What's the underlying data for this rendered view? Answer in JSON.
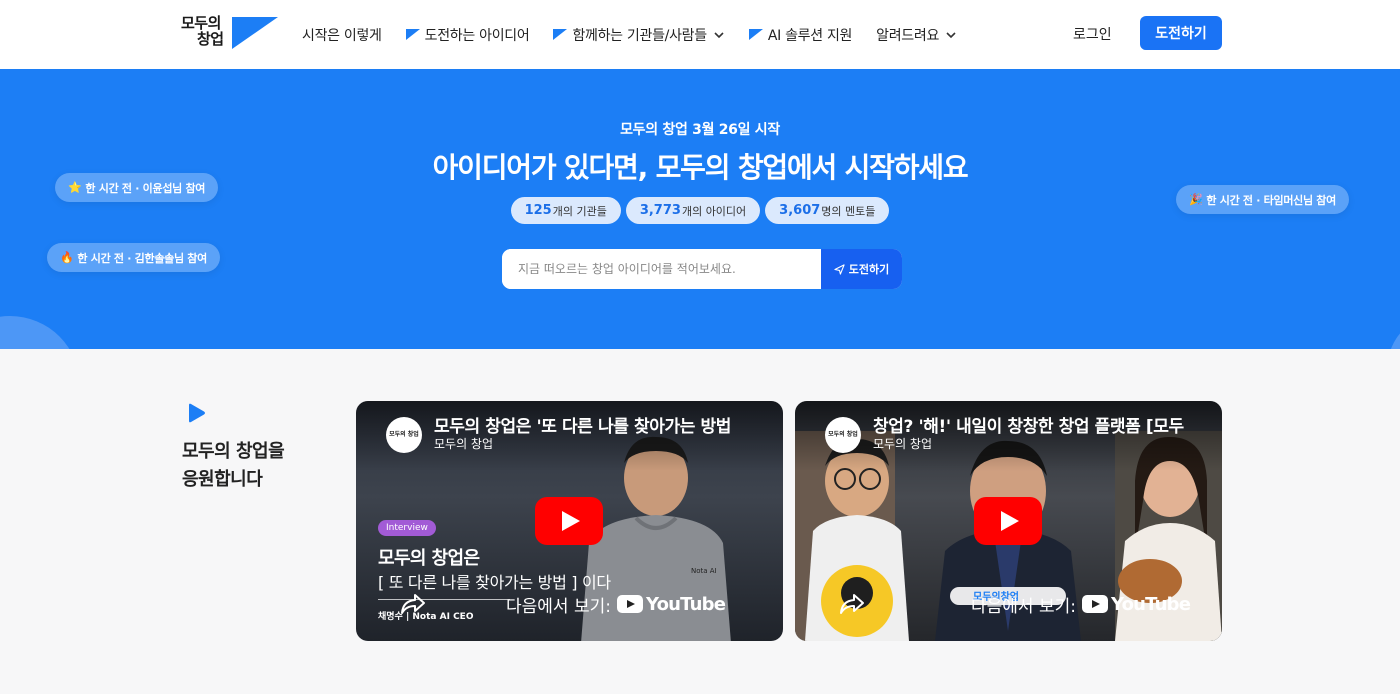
{
  "brand": {
    "logo_line1": "모두의",
    "logo_line2": "창업",
    "accent": "#1c7ef5",
    "button_blue": "#1a73f5"
  },
  "nav": {
    "items": [
      {
        "label": "시작은 이렇게",
        "flag": false,
        "dropdown": false
      },
      {
        "label": "도전하는 아이디어",
        "flag": true,
        "dropdown": false
      },
      {
        "label": "함께하는 기관들/사람들",
        "flag": true,
        "dropdown": true
      },
      {
        "label": "AI 솔루션 지원",
        "flag": true,
        "dropdown": false
      },
      {
        "label": "알려드려요",
        "flag": false,
        "dropdown": true
      }
    ],
    "login": "로그인",
    "cta": "도전하기"
  },
  "hero": {
    "subtitle": "모두의 창업 3월 26일 시작",
    "title": "아이디어가 있다면, 모두의 창업에서 시작하세요",
    "stats": [
      {
        "value": "125",
        "unit": "개의 기관들"
      },
      {
        "value": "3,773",
        "unit": "개의 아이디어"
      },
      {
        "value": "3,607",
        "unit": "명의 멘토들"
      }
    ],
    "search_placeholder": "지금 떠오르는 창업 아이디어를 적어보세요.",
    "search_button": "도전하기",
    "chips": [
      {
        "emoji": "⭐",
        "text": "한 시간 전 · 이윤섭님 참여"
      },
      {
        "emoji": "🔥",
        "text": "한 시간 전 · 김한솔솔님 참여"
      },
      {
        "emoji": "🎉",
        "text": "한 시간 전 · 타임머신님 참여"
      }
    ]
  },
  "support": {
    "title_line1": "모두의 창업을",
    "title_line2": "응원합니다"
  },
  "videos": [
    {
      "title": "모두의 창업은 '또 다른 나를 찾아가는 방법",
      "channel": "모두의 창업",
      "badge": "Interview",
      "overlay_line1": "모두의 창업은",
      "overlay_line2": "[ 또 다른 나를 찾아가는 방법 ] 이다",
      "credit": "채명수 | Nota AI CEO",
      "watch_on": "다음에서 보기:",
      "platform": "YouTube"
    },
    {
      "title": "창업? '해!' 내일이 창창한 창업 플랫폼 [모두",
      "channel": "모두의 창업",
      "watch_on": "다음에서 보기:",
      "platform": "YouTube"
    }
  ],
  "avatar_text": "모두의 창업"
}
